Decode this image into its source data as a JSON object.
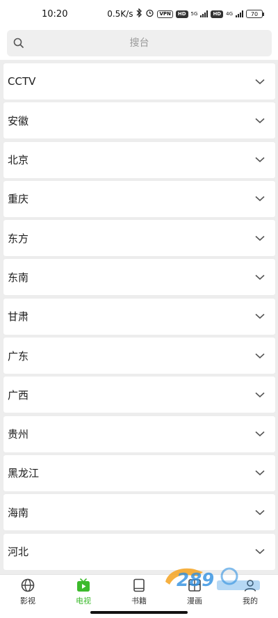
{
  "status_bar": {
    "time": "10:20",
    "net_speed": "0.5K/s",
    "vpn": "VPN",
    "hd1": "HD",
    "net1": "5G",
    "hd2": "HD",
    "net2": "4G",
    "battery": "70"
  },
  "search": {
    "placeholder": "搜台"
  },
  "channels": [
    {
      "label": "CCTV"
    },
    {
      "label": "安徽"
    },
    {
      "label": "北京"
    },
    {
      "label": "重庆"
    },
    {
      "label": "东方"
    },
    {
      "label": "东南"
    },
    {
      "label": "甘肃"
    },
    {
      "label": "广东"
    },
    {
      "label": "广西"
    },
    {
      "label": "贵州"
    },
    {
      "label": "黑龙江"
    },
    {
      "label": "海南"
    },
    {
      "label": "河北"
    }
  ],
  "tabbar": {
    "tabs": [
      {
        "label": "影视",
        "icon": "globe-icon"
      },
      {
        "label": "电视",
        "icon": "tv-icon",
        "active": true
      },
      {
        "label": "书籍",
        "icon": "book-icon"
      },
      {
        "label": "漫画",
        "icon": "comic-icon"
      },
      {
        "label": "我的",
        "icon": "profile-icon"
      }
    ]
  },
  "colors": {
    "accent": "#3cba2c",
    "background": "#ededed"
  }
}
